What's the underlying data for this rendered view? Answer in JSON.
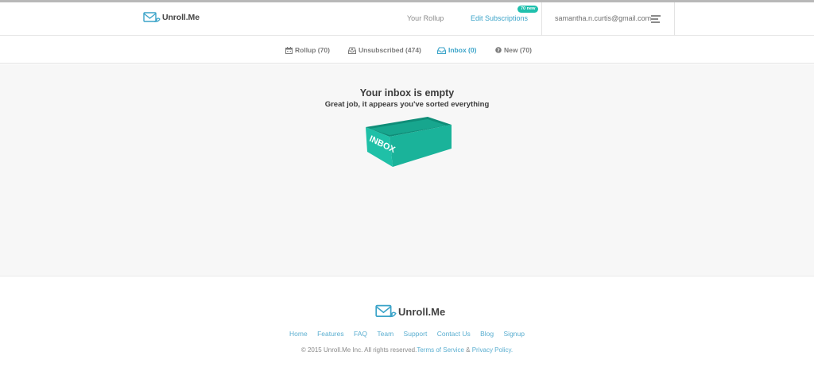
{
  "header": {
    "logo_text": "Unroll.Me",
    "nav": {
      "rollup_label": "Your Rollup",
      "edit_label": "Edit Subscriptions",
      "edit_badge": "70 new"
    },
    "user_email": "samantha.n.curtis@gmail.com"
  },
  "tabs": [
    {
      "label": "Rollup (70)",
      "icon": "calendar-icon"
    },
    {
      "label": "Unsubscribed (474)",
      "icon": "tray-x-icon"
    },
    {
      "label": "Inbox (0)",
      "icon": "inbox-tray-icon",
      "active": true
    },
    {
      "label": "New (70)",
      "icon": "question-circle-icon"
    }
  ],
  "main": {
    "title": "Your inbox is empty",
    "subtitle": "Great job, it appears you've sorted everything",
    "box_label": "INBOX"
  },
  "footer": {
    "logo_text": "Unroll.Me",
    "links": [
      "Home",
      "Features",
      "FAQ",
      "Team",
      "Support",
      "Contact Us",
      "Blog",
      "Signup"
    ],
    "copyright_prefix": "© 2015 Unroll.Me Inc. All rights reserved.",
    "terms_label": "Terms of Service",
    "amp": " & ",
    "privacy_label": "Privacy Policy."
  },
  "colors": {
    "accent_blue": "#3aa3c8",
    "badge_teal": "#1fc0ad",
    "box_teal": "#1ab39a"
  }
}
